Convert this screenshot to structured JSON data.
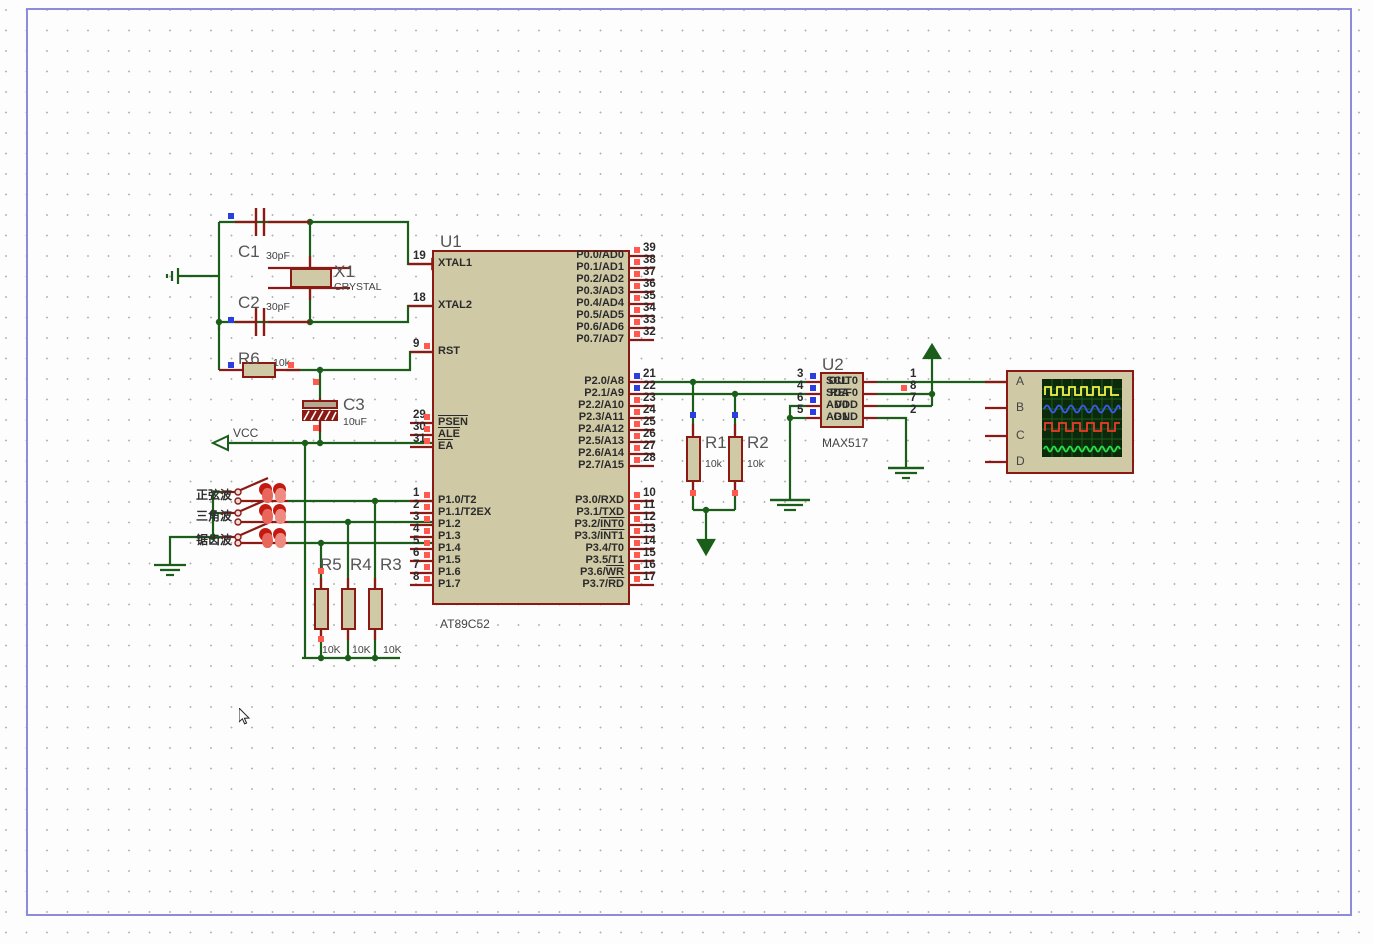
{
  "app": {
    "name": "proteus-isis-schematic",
    "sheet_border_color": "#8c8cd8",
    "wire_color": "#1a5e1a",
    "body_fill": "#cfc9a6",
    "body_stroke": "#8b1a14",
    "pin_red": "#ff5a4d",
    "pin_blue": "#2b3fe0"
  },
  "components": {
    "u1": {
      "ref": "U1",
      "value": "AT89C52",
      "left_pins": [
        {
          "num": "19",
          "name": "XTAL1"
        },
        {
          "num": "18",
          "name": "XTAL2"
        },
        {
          "num": "9",
          "name": "RST"
        },
        {
          "num": "29",
          "name": "PSEN",
          "overline": true
        },
        {
          "num": "30",
          "name": "ALE",
          "overline": true
        },
        {
          "num": "31",
          "name": "EA",
          "overline": true
        },
        {
          "num": "1",
          "name": "P1.0/T2"
        },
        {
          "num": "2",
          "name": "P1.1/T2EX"
        },
        {
          "num": "3",
          "name": "P1.2"
        },
        {
          "num": "4",
          "name": "P1.3"
        },
        {
          "num": "5",
          "name": "P1.4"
        },
        {
          "num": "6",
          "name": "P1.5"
        },
        {
          "num": "7",
          "name": "P1.6"
        },
        {
          "num": "8",
          "name": "P1.7"
        }
      ],
      "right_pins_p0": [
        {
          "num": "39",
          "name": "P0.0/AD0"
        },
        {
          "num": "38",
          "name": "P0.1/AD1"
        },
        {
          "num": "37",
          "name": "P0.2/AD2"
        },
        {
          "num": "36",
          "name": "P0.3/AD3"
        },
        {
          "num": "35",
          "name": "P0.4/AD4"
        },
        {
          "num": "34",
          "name": "P0.5/AD5"
        },
        {
          "num": "33",
          "name": "P0.6/AD6"
        },
        {
          "num": "32",
          "name": "P0.7/AD7"
        }
      ],
      "right_pins_p2": [
        {
          "num": "21",
          "name": "P2.0/A8"
        },
        {
          "num": "22",
          "name": "P2.1/A9"
        },
        {
          "num": "23",
          "name": "P2.2/A10"
        },
        {
          "num": "24",
          "name": "P2.3/A11"
        },
        {
          "num": "25",
          "name": "P2.4/A12"
        },
        {
          "num": "26",
          "name": "P2.5/A13"
        },
        {
          "num": "27",
          "name": "P2.6/A14"
        },
        {
          "num": "28",
          "name": "P2.7/A15"
        }
      ],
      "right_pins_p3": [
        {
          "num": "10",
          "name": "P3.0/RXD"
        },
        {
          "num": "11",
          "name": "P3.1/TXD"
        },
        {
          "num": "12",
          "name": "P3.2/INT0",
          "overline_part": "INT0"
        },
        {
          "num": "13",
          "name": "P3.3/INT1",
          "overline_part": "INT1"
        },
        {
          "num": "14",
          "name": "P3.4/T0"
        },
        {
          "num": "15",
          "name": "P3.5/T1"
        },
        {
          "num": "16",
          "name": "P3.6/WR",
          "overline_part": "WR"
        },
        {
          "num": "17",
          "name": "P3.7/RD",
          "overline_part": "RD"
        }
      ]
    },
    "u2": {
      "ref": "U2",
      "value": "MAX517",
      "left_pins": [
        {
          "num": "3",
          "name": "SCL"
        },
        {
          "num": "4",
          "name": "SDA"
        },
        {
          "num": "6",
          "name": "AD0"
        },
        {
          "num": "5",
          "name": "AD1"
        }
      ],
      "right_pins": [
        {
          "num": "1",
          "name": "OUT0"
        },
        {
          "num": "8",
          "name": "REF0"
        },
        {
          "num": "7",
          "name": "VDD"
        },
        {
          "num": "2",
          "name": "GND"
        }
      ]
    },
    "x1": {
      "ref": "X1",
      "value": "CRYSTAL"
    },
    "c1": {
      "ref": "C1",
      "value": "30pF"
    },
    "c2": {
      "ref": "C2",
      "value": "30pF"
    },
    "c3": {
      "ref": "C3",
      "value": "10uF"
    },
    "r1": {
      "ref": "R1",
      "value": "10k"
    },
    "r2": {
      "ref": "R2",
      "value": "10k"
    },
    "r3": {
      "ref": "R3",
      "value": "10K"
    },
    "r4": {
      "ref": "R4",
      "value": "10K"
    },
    "r5": {
      "ref": "R5",
      "value": "10K"
    },
    "r6": {
      "ref": "R6",
      "value": "10k"
    }
  },
  "switches": [
    {
      "label": "正弦波"
    },
    {
      "label": "三角波"
    },
    {
      "label": "锯齿波"
    }
  ],
  "power": {
    "vcc_label": "VCC"
  },
  "scope": {
    "channels": [
      "A",
      "B",
      "C",
      "D"
    ],
    "traces": [
      {
        "channel": "A",
        "color": "#f2f24a",
        "shape": "square"
      },
      {
        "channel": "B",
        "color": "#3a5cf0",
        "shape": "sine"
      },
      {
        "channel": "C",
        "color": "#f03a2a",
        "shape": "square"
      },
      {
        "channel": "D",
        "color": "#2ae04a",
        "shape": "sine"
      }
    ],
    "screen_bg": "#0a2a0a",
    "grid_color": "#1d5a1d"
  }
}
